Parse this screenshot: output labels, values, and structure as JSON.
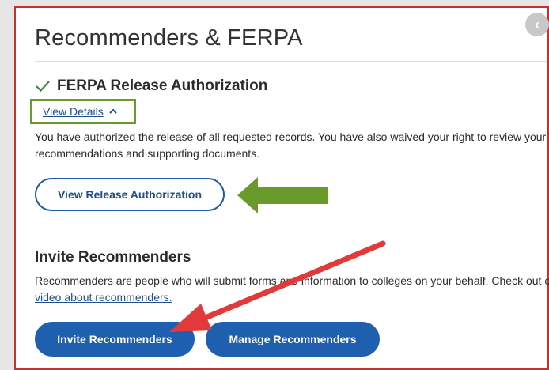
{
  "page": {
    "title": "Recommenders & FERPA",
    "close_glyph": "‹"
  },
  "ferpa": {
    "section_title": "FERPA Release Authorization",
    "details_link": "View Details",
    "description": "You have authorized the release of all requested records. You have also waived your right to review your recommendations and supporting documents.",
    "view_release_button": "View Release Authorization"
  },
  "invite": {
    "section_title": "Invite Recommenders",
    "description_prefix": "Recommenders are people who will submit forms and information to colleges on your behalf. Check out our ",
    "video_link": "video about recommenders.",
    "invite_button": "Invite Recommenders",
    "manage_button": "Manage Recommenders"
  },
  "colors": {
    "brand_blue": "#1f5fb0",
    "check_green": "#3a8a3a",
    "highlight_green": "#6a9a2a",
    "annotation_red": "#e23a3a",
    "frame_red": "#c9302c"
  },
  "icons": [
    "check-icon",
    "chevron-up-icon",
    "close-circle-icon"
  ]
}
